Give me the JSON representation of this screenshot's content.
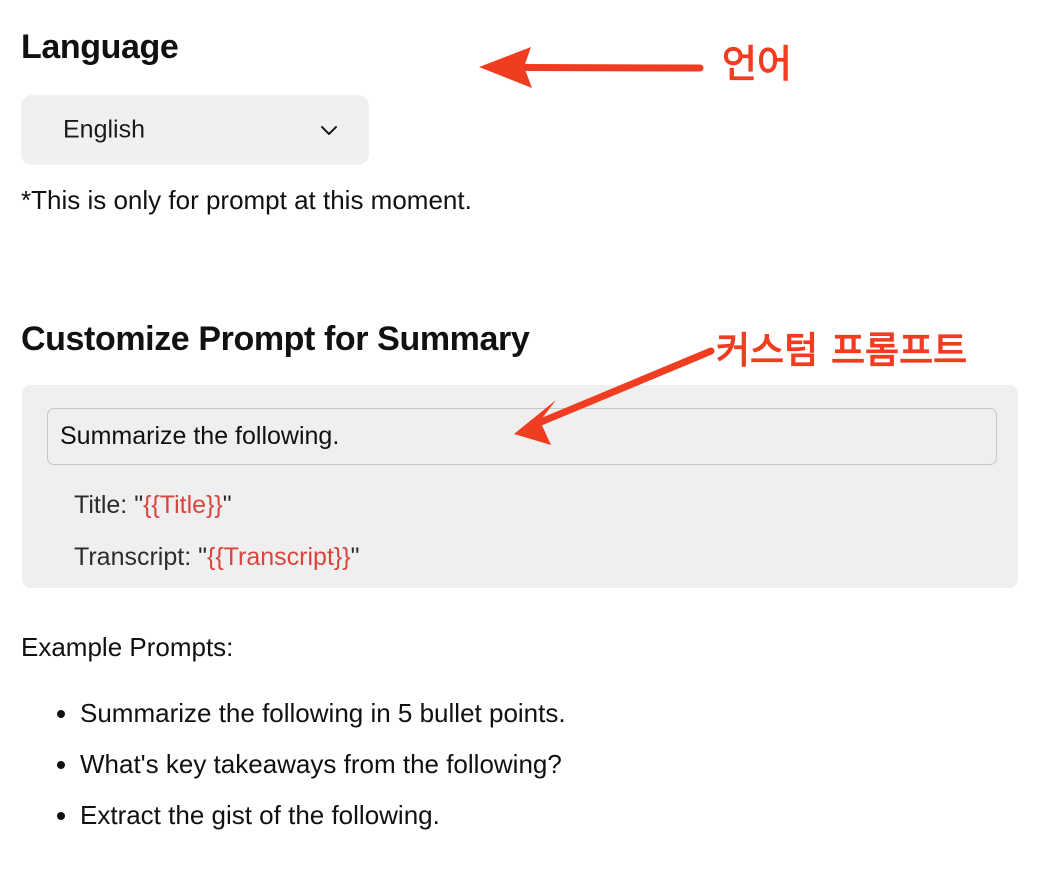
{
  "language_section": {
    "heading": "Language",
    "select": {
      "value": "English",
      "icon": "chevron-down-icon"
    },
    "note": "*This is only for prompt at this moment.",
    "annotation": {
      "text": "언어",
      "icon": "arrow-left-icon",
      "color": "#f03c20"
    }
  },
  "customize_section": {
    "heading": "Customize Prompt for Summary",
    "prompt_input": {
      "value": "Summarize the following.",
      "placeholder": "Summarize the following."
    },
    "template": {
      "title_label": "Title: \"",
      "title_token": "{{Title}}",
      "title_close": "\"",
      "transcript_label": "Transcript: \"",
      "transcript_token": "{{Transcript}}",
      "transcript_close": "\"",
      "token_color": "#d9453c"
    },
    "annotation": {
      "text": "커스텀 프롬프트",
      "icon": "arrow-diagonal-down-left-icon",
      "color": "#f03c20"
    }
  },
  "examples": {
    "label": "Example Prompts:",
    "items": [
      "Summarize the following in 5 bullet points.",
      "What's key takeaways from the following?",
      "Extract the gist of the following."
    ]
  }
}
